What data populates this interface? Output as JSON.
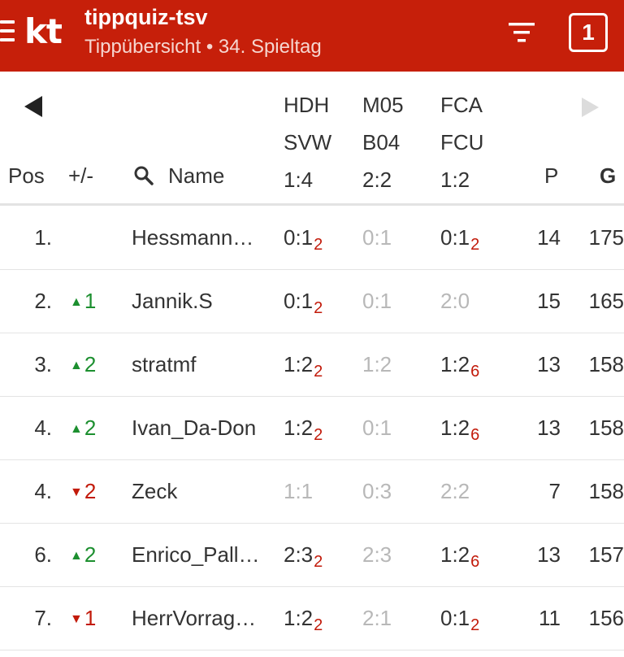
{
  "header": {
    "logo": "kt",
    "title": "tippquiz-tsv",
    "subtitle": "Tippübersicht • 34. Spieltag",
    "badge": "1",
    "colors": {
      "primary": "#c61f0a"
    },
    "icons": {
      "menu": "menu-icon",
      "filter": "filter-icon"
    }
  },
  "columns": {
    "pos": "Pos",
    "trend": "+/-",
    "name": "Name",
    "points": "P",
    "total": "G",
    "matches": [
      {
        "home": "HDH",
        "away": "SVW",
        "result": "1:4"
      },
      {
        "home": "M05",
        "away": "B04",
        "result": "2:2"
      },
      {
        "home": "FCA",
        "away": "FCU",
        "result": "1:2"
      }
    ]
  },
  "rows": [
    {
      "pos": "1.",
      "trend_dir": "",
      "trend": "",
      "name": "Hessmann…",
      "tips": [
        {
          "score": "0:1",
          "pts": "2",
          "style": "dark"
        },
        {
          "score": "0:1",
          "pts": "",
          "style": "gray"
        },
        {
          "score": "0:1",
          "pts": "2",
          "style": "dark"
        }
      ],
      "p": "14",
      "g": "175"
    },
    {
      "pos": "2.",
      "trend_dir": "up",
      "trend": "1",
      "name": "Jannik.S",
      "tips": [
        {
          "score": "0:1",
          "pts": "2",
          "style": "dark"
        },
        {
          "score": "0:1",
          "pts": "",
          "style": "gray"
        },
        {
          "score": "2:0",
          "pts": "",
          "style": "gray"
        }
      ],
      "p": "15",
      "g": "165"
    },
    {
      "pos": "3.",
      "trend_dir": "up",
      "trend": "2",
      "name": "stratmf",
      "tips": [
        {
          "score": "1:2",
          "pts": "2",
          "style": "dark"
        },
        {
          "score": "1:2",
          "pts": "",
          "style": "gray"
        },
        {
          "score": "1:2",
          "pts": "6",
          "style": "dark"
        }
      ],
      "p": "13",
      "g": "158"
    },
    {
      "pos": "4.",
      "trend_dir": "up",
      "trend": "2",
      "name": "Ivan_Da-Don",
      "tips": [
        {
          "score": "1:2",
          "pts": "2",
          "style": "dark"
        },
        {
          "score": "0:1",
          "pts": "",
          "style": "gray"
        },
        {
          "score": "1:2",
          "pts": "6",
          "style": "dark"
        }
      ],
      "p": "13",
      "g": "158"
    },
    {
      "pos": "4.",
      "trend_dir": "down",
      "trend": "2",
      "name": "Zeck",
      "tips": [
        {
          "score": "1:1",
          "pts": "",
          "style": "gray"
        },
        {
          "score": "0:3",
          "pts": "",
          "style": "gray"
        },
        {
          "score": "2:2",
          "pts": "",
          "style": "gray"
        }
      ],
      "p": "7",
      "g": "158"
    },
    {
      "pos": "6.",
      "trend_dir": "up",
      "trend": "2",
      "name": "Enrico_Pall…",
      "tips": [
        {
          "score": "2:3",
          "pts": "2",
          "style": "dark"
        },
        {
          "score": "2:3",
          "pts": "",
          "style": "gray"
        },
        {
          "score": "1:2",
          "pts": "6",
          "style": "dark"
        }
      ],
      "p": "13",
      "g": "157"
    },
    {
      "pos": "7.",
      "trend_dir": "down",
      "trend": "1",
      "name": "HerrVorrag…",
      "tips": [
        {
          "score": "1:2",
          "pts": "2",
          "style": "dark"
        },
        {
          "score": "2:1",
          "pts": "",
          "style": "gray"
        },
        {
          "score": "0:1",
          "pts": "2",
          "style": "dark"
        }
      ],
      "p": "11",
      "g": "156"
    }
  ]
}
